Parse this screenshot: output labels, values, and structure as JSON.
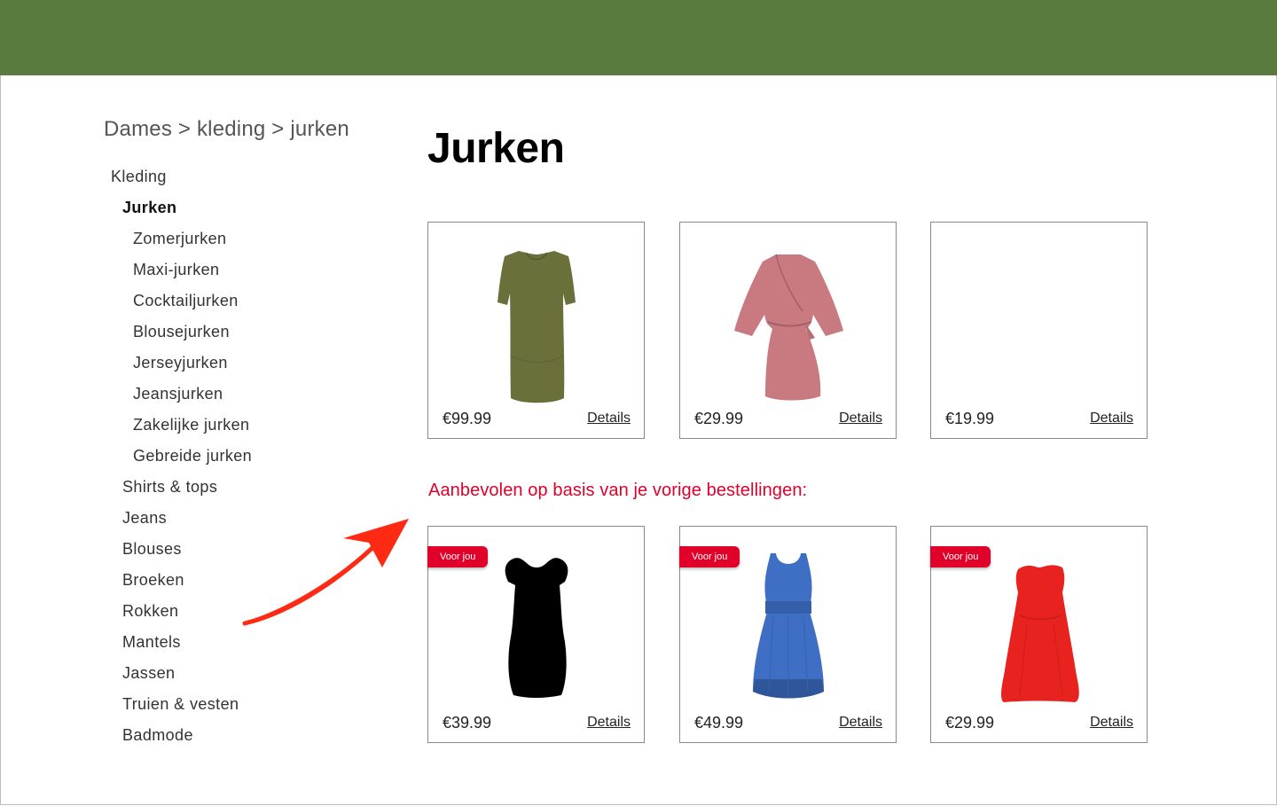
{
  "breadcrumb": "Dames > kleding > jurken",
  "nav": {
    "items": [
      {
        "label": "Kleding"
      },
      {
        "label": "Jurken"
      },
      {
        "label": "Zomerjurken"
      },
      {
        "label": "Maxi-jurken"
      },
      {
        "label": "Cocktailjurken"
      },
      {
        "label": "Blousejurken"
      },
      {
        "label": "Jerseyjurken"
      },
      {
        "label": "Jeansjurken"
      },
      {
        "label": "Zakelijke jurken"
      },
      {
        "label": "Gebreide jurken"
      },
      {
        "label": "Shirts & tops"
      },
      {
        "label": "Jeans"
      },
      {
        "label": "Blouses"
      },
      {
        "label": "Broeken"
      },
      {
        "label": "Rokken"
      },
      {
        "label": "Mantels"
      },
      {
        "label": "Jassen"
      },
      {
        "label": "Truien & vesten"
      },
      {
        "label": "Badmode"
      }
    ],
    "active": "Jurken"
  },
  "page_title": "Jurken",
  "products": [
    {
      "price": "€99.99",
      "details_label": "Details",
      "image": "olive-tshirt-dress"
    },
    {
      "price": "€29.99",
      "details_label": "Details",
      "image": "pink-wrap-dress"
    },
    {
      "price": "€19.99",
      "details_label": "Details",
      "image": "empty"
    }
  ],
  "recommended": {
    "heading": "Aanbevolen op basis van je vorige bestellingen:",
    "badge_label": "Voor jou",
    "items": [
      {
        "price": "€39.99",
        "details_label": "Details",
        "image": "black-dress"
      },
      {
        "price": "€49.99",
        "details_label": "Details",
        "image": "blue-dress"
      },
      {
        "price": "€29.99",
        "details_label": "Details",
        "image": "red-dress"
      }
    ]
  },
  "colors": {
    "header": "#5a7b3e",
    "accent_red": "#e0002a",
    "arrow": "#ff2a14"
  }
}
